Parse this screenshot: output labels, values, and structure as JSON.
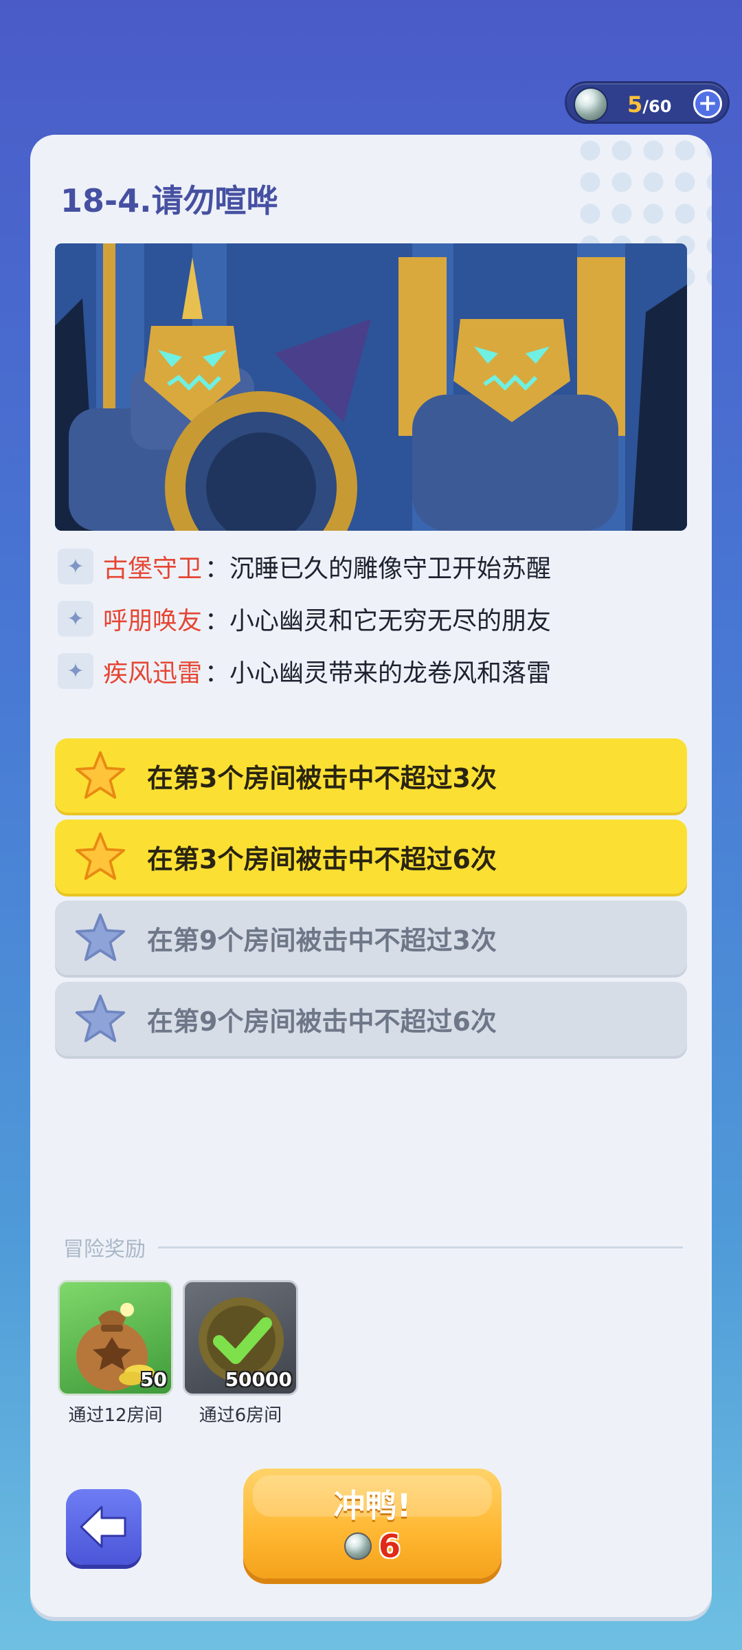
{
  "energy": {
    "current": "5",
    "max": "/60",
    "orb_icon": "energy-orb-icon",
    "plus_label": "+"
  },
  "level": {
    "title": "18-4.请勿喧哗"
  },
  "traits": [
    {
      "icon": "sparkle-icon",
      "name": "古堡守卫",
      "desc": "：沉睡已久的雕像守卫开始苏醒"
    },
    {
      "icon": "sparkle-icon",
      "name": "呼朋唤友",
      "desc": "：小心幽灵和它无穷无尽的朋友"
    },
    {
      "icon": "sparkle-icon",
      "name": "疾风迅雷",
      "desc": "：小心幽灵带来的龙卷风和落雷"
    }
  ],
  "objectives": [
    {
      "text": "在第3个房间被击中不超过3次",
      "achieved": true
    },
    {
      "text": "在第3个房间被击中不超过6次",
      "achieved": true
    },
    {
      "text": "在第9个房间被击中不超过3次",
      "achieved": false
    },
    {
      "text": "在第9个房间被击中不超过6次",
      "achieved": false
    }
  ],
  "rewards": {
    "header": "冒险奖励",
    "items": [
      {
        "icon": "gold-bag-icon",
        "count": "50",
        "label": "通过12房间",
        "claimed": false
      },
      {
        "icon": "checkmark-coin-icon",
        "count": "50000",
        "label": "通过6房间",
        "claimed": true
      }
    ]
  },
  "buttons": {
    "back_icon": "back-arrow-icon",
    "go_label": "冲鸭!",
    "go_cost": "6"
  },
  "colors": {
    "trait_name": "#e64533",
    "objective_achieved": "#fbe033",
    "objective_pending": "#d6dde7",
    "title": "#4650a2"
  }
}
